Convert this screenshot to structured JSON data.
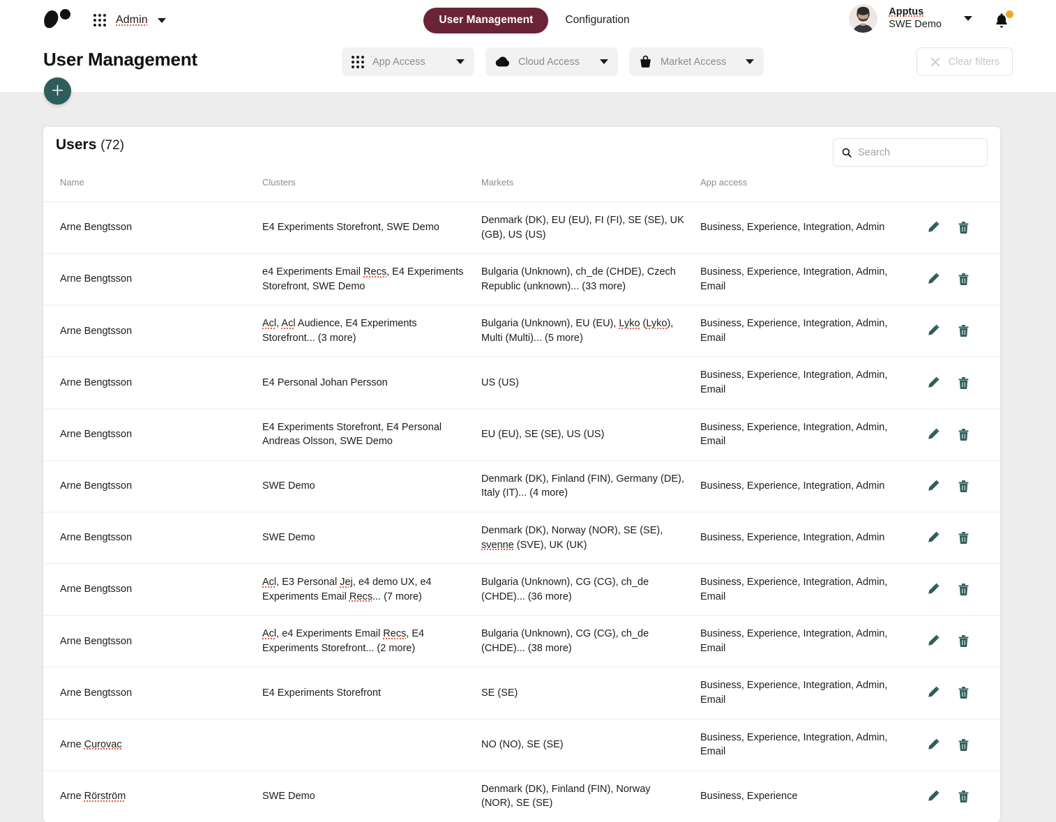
{
  "topbar": {
    "logo_name": "apptus-logo",
    "app_switcher_label": "Admin",
    "nav": [
      {
        "label": "User Management",
        "active": true
      },
      {
        "label": "Configuration",
        "active": false
      }
    ],
    "user": {
      "org": "Apptus",
      "sub": "SWE Demo"
    },
    "notifications_badge": true
  },
  "titlebar": {
    "title": "User Management",
    "add_label": "+",
    "filters": [
      {
        "icon": "grid-icon",
        "label": "App Access"
      },
      {
        "icon": "cloud-icon",
        "label": "Cloud Access"
      },
      {
        "icon": "basket-icon",
        "label": "Market Access"
      }
    ],
    "clear_filters_label": "Clear filters"
  },
  "card": {
    "title": "Users",
    "count": "(72)",
    "search_placeholder": "Search",
    "search_value": "",
    "columns": [
      "Name",
      "Clusters",
      "Markets",
      "App access"
    ],
    "rows": [
      {
        "name": "Arne Bengtsson",
        "clusters": "E4 Experiments Storefront, SWE Demo",
        "markets": "Denmark (DK), EU (EU), FI (FI), SE (SE), UK (GB), US (US)",
        "app_access": "Business, Experience, Integration, Admin"
      },
      {
        "name": "Arne Bengtsson",
        "clusters": "e4 Experiments Email Recs, E4 Experiments Storefront, SWE Demo",
        "markets": "Bulgaria (Unknown), ch_de (CHDE), Czech Republic (unknown)... (33 more)",
        "app_access": "Business, Experience, Integration, Admin, Email"
      },
      {
        "name": "Arne Bengtsson",
        "clusters": "Acl, Acl Audience, E4 Experiments Storefront... (3 more)",
        "markets": "Bulgaria (Unknown), EU (EU), Lyko (Lyko), Multi (Multi)... (5 more)",
        "app_access": "Business, Experience, Integration, Admin, Email"
      },
      {
        "name": "Arne Bengtsson",
        "clusters": "E4 Personal Johan Persson",
        "markets": "US (US)",
        "app_access": "Business, Experience, Integration, Admin, Email"
      },
      {
        "name": "Arne Bengtsson",
        "clusters": "E4 Experiments Storefront, E4 Personal Andreas Olsson, SWE Demo",
        "markets": "EU (EU), SE (SE), US (US)",
        "app_access": "Business, Experience, Integration, Admin, Email"
      },
      {
        "name": "Arne Bengtsson",
        "clusters": "SWE Demo",
        "markets": "Denmark (DK), Finland (FIN), Germany (DE), Italy (IT)... (4 more)",
        "app_access": "Business, Experience, Integration, Admin"
      },
      {
        "name": "Arne Bengtsson",
        "clusters": "SWE Demo",
        "markets": "Denmark (DK), Norway (NOR), SE (SE), svenne (SVE), UK (UK)",
        "app_access": "Business, Experience, Integration, Admin"
      },
      {
        "name": "Arne Bengtsson",
        "clusters": "Acl, E3 Personal Jej, e4 demo UX, e4 Experiments Email Recs... (7 more)",
        "markets": "Bulgaria (Unknown), CG (CG), ch_de (CHDE)... (36 more)",
        "app_access": "Business, Experience, Integration, Admin, Email"
      },
      {
        "name": "Arne Bengtsson",
        "clusters": "Acl, e4 Experiments Email Recs, E4 Experiments Storefront... (2 more)",
        "markets": "Bulgaria (Unknown), CG (CG), ch_de (CHDE)... (38 more)",
        "app_access": "Business, Experience, Integration, Admin, Email"
      },
      {
        "name": "Arne Bengtsson",
        "clusters": "E4 Experiments Storefront",
        "markets": "SE (SE)",
        "app_access": "Business, Experience, Integration, Admin, Email"
      },
      {
        "name": "Arne Curovac",
        "clusters": "",
        "markets": "NO (NO), SE (SE)",
        "app_access": "Business, Experience, Integration, Admin, Email"
      },
      {
        "name": "Arne Rörström",
        "clusters": "SWE Demo",
        "markets": "Denmark (DK), Finland (FIN), Norway (NOR), SE (SE)",
        "app_access": "Business, Experience"
      }
    ],
    "row_actions": {
      "edit": "edit-icon",
      "delete": "delete-icon"
    }
  },
  "colors": {
    "accent_burgundy": "#6b2337",
    "accent_teal": "#2e5e5b",
    "badge_orange": "#f5a623",
    "page_bg": "#ededed"
  }
}
